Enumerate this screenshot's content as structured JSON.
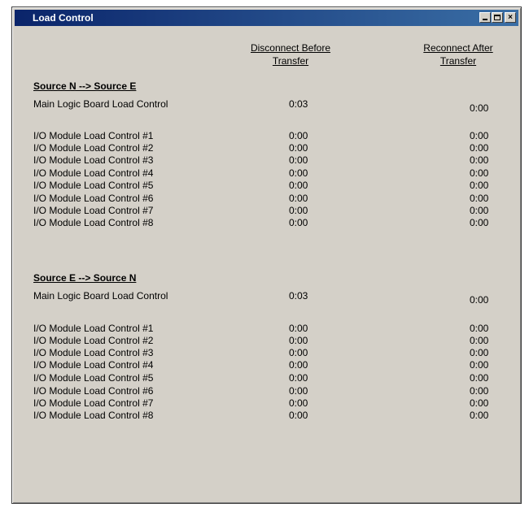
{
  "window": {
    "title": "Load Control"
  },
  "columns": {
    "disconnect_line1": "Disconnect Before",
    "disconnect_line2": "Transfer",
    "reconnect_line1": "Reconnect After",
    "reconnect_line2": "Transfer"
  },
  "sections": [
    {
      "title": "Source N --> Source E",
      "main": {
        "label": "Main Logic Board Load Control",
        "disconnect": "0:03",
        "reconnect": "0:00"
      },
      "modules": [
        {
          "label": "I/O Module Load Control #1",
          "disconnect": "0:00",
          "reconnect": "0:00"
        },
        {
          "label": "I/O Module Load Control #2",
          "disconnect": "0:00",
          "reconnect": "0:00"
        },
        {
          "label": "I/O Module Load Control #3",
          "disconnect": "0:00",
          "reconnect": "0:00"
        },
        {
          "label": "I/O Module Load Control #4",
          "disconnect": "0:00",
          "reconnect": "0:00"
        },
        {
          "label": "I/O Module Load Control #5",
          "disconnect": "0:00",
          "reconnect": "0:00"
        },
        {
          "label": "I/O Module Load Control #6",
          "disconnect": "0:00",
          "reconnect": "0:00"
        },
        {
          "label": "I/O Module Load Control #7",
          "disconnect": "0:00",
          "reconnect": "0:00"
        },
        {
          "label": "I/O Module Load Control #8",
          "disconnect": "0:00",
          "reconnect": "0:00"
        }
      ]
    },
    {
      "title": "Source E --> Source N",
      "main": {
        "label": "Main Logic Board Load Control",
        "disconnect": "0:03",
        "reconnect": "0:00"
      },
      "modules": [
        {
          "label": "I/O Module Load Control #1",
          "disconnect": "0:00",
          "reconnect": "0:00"
        },
        {
          "label": "I/O Module Load Control #2",
          "disconnect": "0:00",
          "reconnect": "0:00"
        },
        {
          "label": "I/O Module Load Control #3",
          "disconnect": "0:00",
          "reconnect": "0:00"
        },
        {
          "label": "I/O Module Load Control #4",
          "disconnect": "0:00",
          "reconnect": "0:00"
        },
        {
          "label": "I/O Module Load Control #5",
          "disconnect": "0:00",
          "reconnect": "0:00"
        },
        {
          "label": "I/O Module Load Control #6",
          "disconnect": "0:00",
          "reconnect": "0:00"
        },
        {
          "label": "I/O Module Load Control #7",
          "disconnect": "0:00",
          "reconnect": "0:00"
        },
        {
          "label": "I/O Module Load Control #8",
          "disconnect": "0:00",
          "reconnect": "0:00"
        }
      ]
    }
  ]
}
